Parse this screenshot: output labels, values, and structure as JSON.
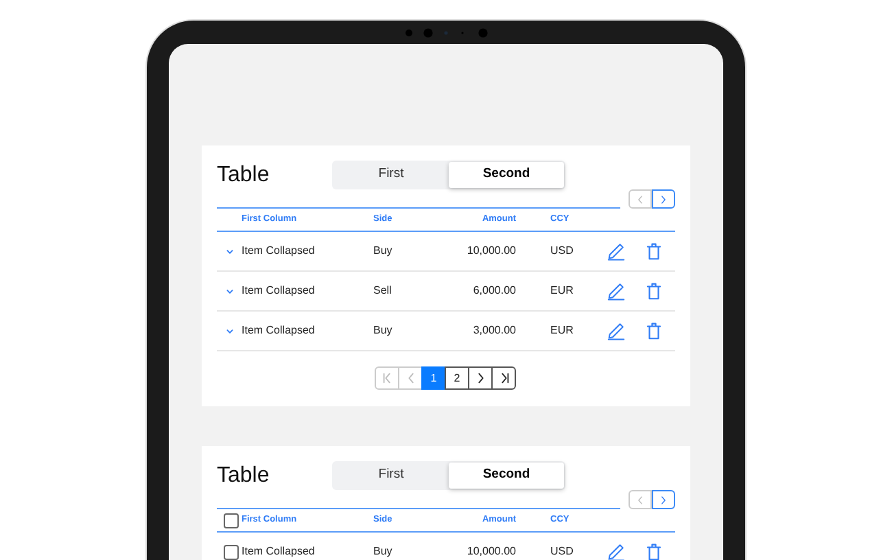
{
  "tables": [
    {
      "title": "Table",
      "kind": "expandable",
      "segments": [
        {
          "label": "First",
          "selected": false
        },
        {
          "label": "Second",
          "selected": true
        }
      ],
      "scroller": {
        "prev_disabled": true,
        "next_disabled": false
      },
      "columns": [
        "First Column",
        "Side",
        "Amount",
        "CCY"
      ],
      "rows": [
        {
          "expanded": false,
          "cells": [
            "Item Collapsed",
            "Buy",
            "10,000.00",
            "USD"
          ]
        },
        {
          "expanded": false,
          "cells": [
            "Item Collapsed",
            "Sell",
            "6,000.00",
            "EUR"
          ]
        },
        {
          "expanded": false,
          "cells": [
            "Item Collapsed",
            "Buy",
            "3,000.00",
            "EUR"
          ]
        }
      ],
      "pagination": {
        "first_disabled": true,
        "prev_disabled": true,
        "next_disabled": false,
        "last_disabled": false,
        "pages": [
          {
            "label": "1",
            "selected": true
          },
          {
            "label": "2",
            "selected": false
          }
        ]
      }
    },
    {
      "title": "Table",
      "kind": "selectable",
      "segments": [
        {
          "label": "First",
          "selected": false
        },
        {
          "label": "Second",
          "selected": true
        }
      ],
      "scroller": {
        "prev_disabled": true,
        "next_disabled": false
      },
      "select_all": {
        "checked": false
      },
      "columns": [
        "First Column",
        "Side",
        "Amount",
        "CCY"
      ],
      "rows": [
        {
          "checked": false,
          "cells": [
            "Item Collapsed",
            "Buy",
            "10,000.00",
            "USD"
          ]
        }
      ]
    }
  ]
}
